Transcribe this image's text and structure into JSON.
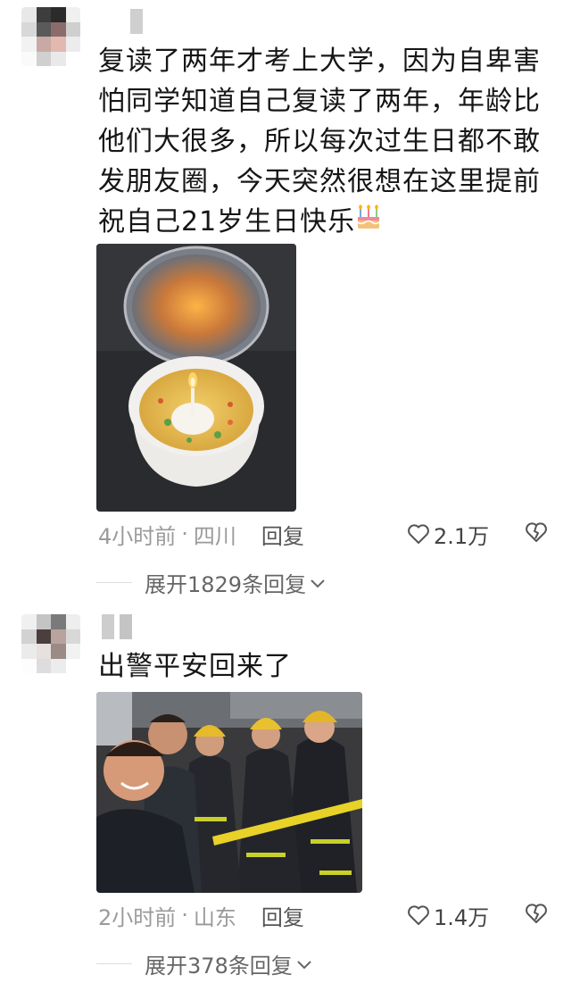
{
  "comments": [
    {
      "text": "复读了两年才考上大学，因为自卑害怕同学知道自己复读了两年，年龄比他们大很多，所以每次过生日都不敢发朋友圈，今天突然很想在这里提前祝自己21岁生日快乐",
      "emoji_icon": "birthday-cake-icon",
      "time": "4小时前",
      "separator": "·",
      "location": "四川",
      "reply_label": "回复",
      "likes": "2.1万",
      "expand_label": "展开1829条回复"
    },
    {
      "text": "出警平安回来了",
      "time": "2小时前",
      "separator": "·",
      "location": "山东",
      "reply_label": "回复",
      "likes": "1.4万",
      "expand_label": "展开378条回复"
    }
  ],
  "colors": {
    "meta": "#9a9a9a",
    "text": "#161616",
    "icon": "#555555"
  }
}
